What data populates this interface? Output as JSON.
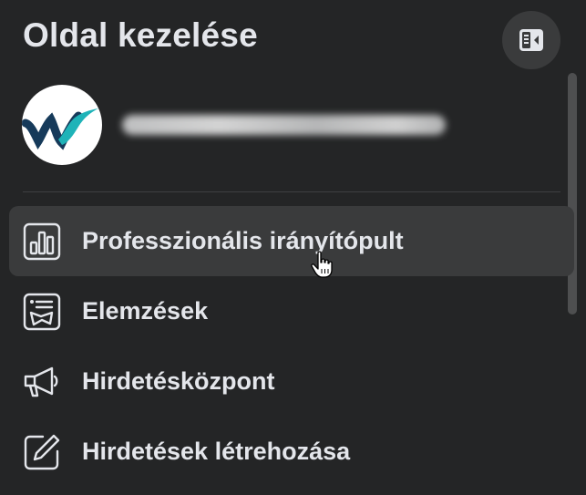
{
  "header": {
    "title": "Oldal kezelése",
    "collapse_icon": "sidebar-collapse-icon"
  },
  "page": {
    "avatar_icon": "brand-logo-icon",
    "name": ""
  },
  "menu": {
    "items": [
      {
        "label": "Professzionális irányítópult",
        "icon": "dashboard-chart-icon",
        "active": true
      },
      {
        "label": "Elemzések",
        "icon": "insights-icon",
        "active": false
      },
      {
        "label": "Hirdetésközpont",
        "icon": "megaphone-icon",
        "active": false
      },
      {
        "label": "Hirdetések létrehozása",
        "icon": "pencil-edit-icon",
        "active": false
      }
    ]
  },
  "colors": {
    "background": "#242526",
    "hover": "#3a3b3c",
    "text": "#e4e6eb",
    "logo_teal": "#1fb3b8",
    "logo_navy": "#163a5a"
  }
}
